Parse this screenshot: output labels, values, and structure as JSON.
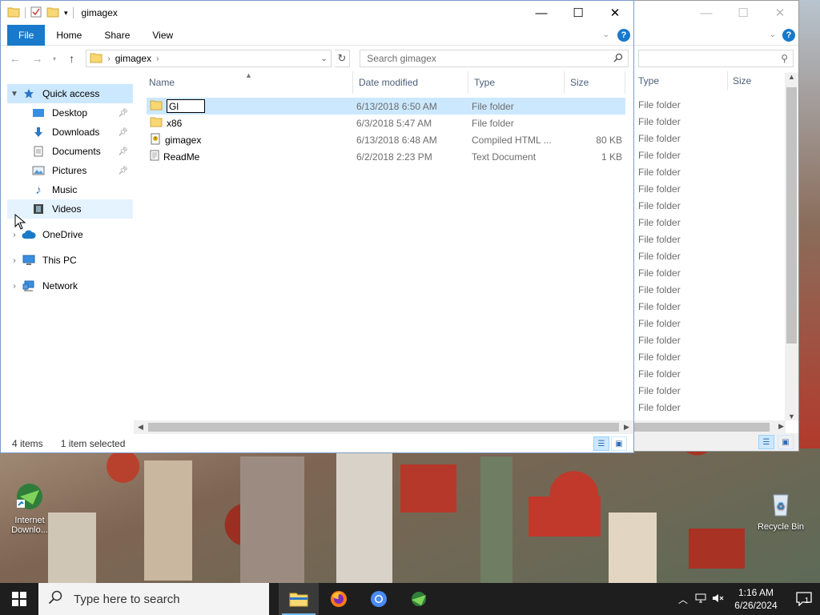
{
  "window": {
    "title": "gimagex",
    "controls": [
      "—",
      "☐",
      "✕"
    ]
  },
  "ribbon": {
    "tabs": [
      "File",
      "Home",
      "Share",
      "View"
    ],
    "help": "?"
  },
  "address": {
    "crumbs": [
      "gimagex"
    ],
    "search_placeholder": "Search gimagex"
  },
  "nav": {
    "quick_access": "Quick access",
    "quick_items": [
      {
        "label": "Desktop",
        "pinned": true
      },
      {
        "label": "Downloads",
        "pinned": true
      },
      {
        "label": "Documents",
        "pinned": true
      },
      {
        "label": "Pictures",
        "pinned": true
      },
      {
        "label": "Music",
        "pinned": false
      },
      {
        "label": "Videos",
        "pinned": false
      }
    ],
    "onedrive": "OneDrive",
    "thispc": "This PC",
    "network": "Network"
  },
  "columns": {
    "name": "Name",
    "date": "Date modified",
    "type": "Type",
    "size": "Size"
  },
  "files": [
    {
      "name": "Gl",
      "date": "6/13/2018 6:50 AM",
      "type": "File folder",
      "size": "",
      "icon": "folder-icon",
      "renaming": true
    },
    {
      "name": "x86",
      "date": "6/3/2018 5:47 AM",
      "type": "File folder",
      "size": "",
      "icon": "folder-icon"
    },
    {
      "name": "gimagex",
      "date": "6/13/2018 6:48 AM",
      "type": "Compiled HTML ...",
      "size": "80 KB",
      "icon": "chm-icon"
    },
    {
      "name": "ReadMe",
      "date": "6/2/2018 2:23 PM",
      "type": "Text Document",
      "size": "1 KB",
      "icon": "text-file-icon"
    }
  ],
  "status": {
    "count": "4 items",
    "selection": "1 item selected"
  },
  "bg_window": {
    "col_type": "Type",
    "col_size": "Size",
    "rows": [
      "File folder",
      "File folder",
      "File folder",
      "File folder",
      "File folder",
      "File folder",
      "File folder",
      "File folder",
      "File folder",
      "File folder",
      "File folder",
      "File folder",
      "File folder",
      "File folder",
      "File folder",
      "File folder",
      "File folder",
      "File folder",
      "File folder"
    ]
  },
  "desktop": {
    "icons": [
      {
        "label": "Internet Downlo..."
      },
      {
        "label": "Recycle Bin"
      }
    ]
  },
  "taskbar": {
    "search_placeholder": "Type here to search",
    "time": "1:16 AM",
    "date": "6/26/2024",
    "notifications": "1"
  },
  "colors": {
    "accent": "#1979ca",
    "selection": "#cce8ff",
    "taskbar": "#1e1e1e"
  }
}
